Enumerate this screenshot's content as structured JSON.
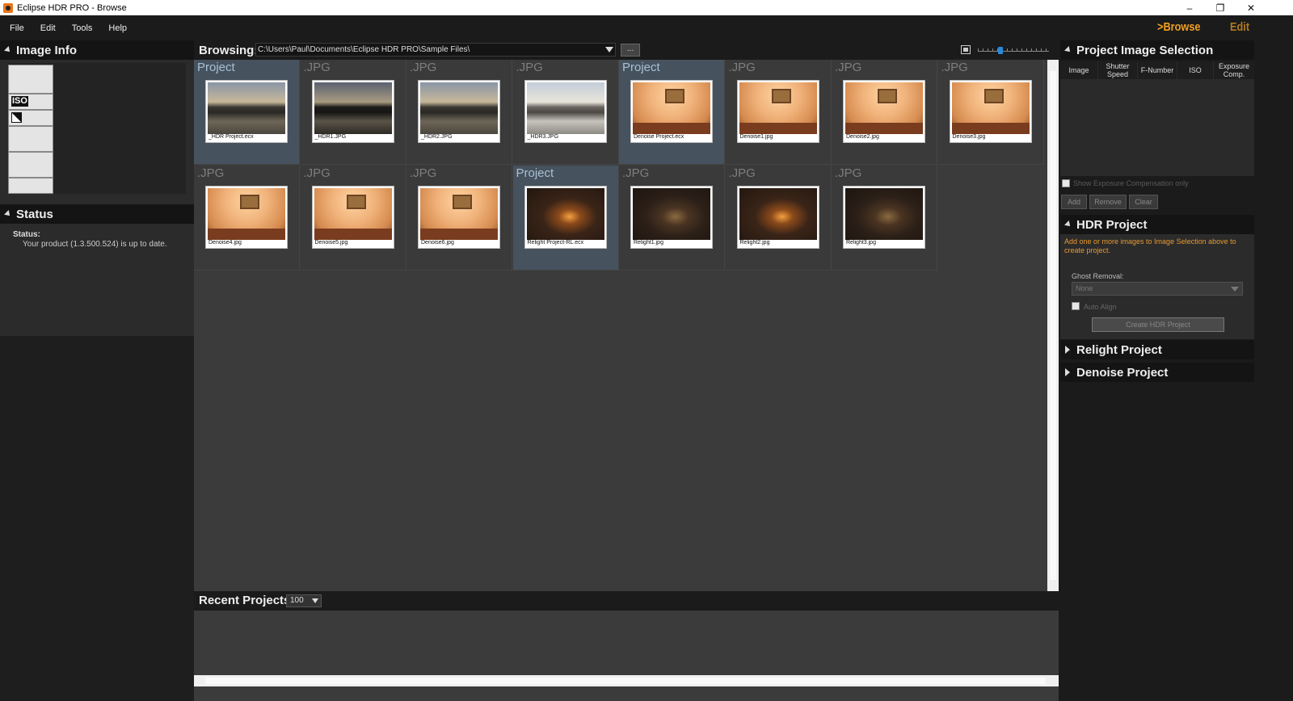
{
  "window": {
    "title": "Eclipse HDR PRO - Browse",
    "minimize": "–",
    "restore": "❐",
    "close": "✕"
  },
  "menu": [
    "File",
    "Edit",
    "Tools",
    "Help"
  ],
  "modes": {
    "browse": ">Browse",
    "edit": "Edit"
  },
  "left": {
    "image_info_title": "Image Info",
    "iso_label": "ISO",
    "status_title": "Status",
    "status_label": "Status:",
    "status_text": "Your product (1.3.500.524) is up to date."
  },
  "browse": {
    "label": "Browsing:",
    "path": "C:\\Users\\Paul\\Documents\\Eclipse HDR PRO\\Sample Files\\",
    "more_button": "...",
    "zoom_level": 0.3
  },
  "thumbnails": [
    {
      "type": "Project",
      "name": "_HDR Project.ecx",
      "kind": "city",
      "tone": ""
    },
    {
      "type": ".JPG",
      "name": "_HDR1.JPG",
      "kind": "city",
      "tone": "dark"
    },
    {
      "type": ".JPG",
      "name": "_HDR2.JPG",
      "kind": "city",
      "tone": ""
    },
    {
      "type": ".JPG",
      "name": "_HDR3.JPG",
      "kind": "city",
      "tone": "bright"
    },
    {
      "type": "Project",
      "name": "Denoise Project.ecx",
      "kind": "vase",
      "tone": ""
    },
    {
      "type": ".JPG",
      "name": "Denoise1.jpg",
      "kind": "vase",
      "tone": ""
    },
    {
      "type": ".JPG",
      "name": "Denoise2.jpg",
      "kind": "vase",
      "tone": ""
    },
    {
      "type": ".JPG",
      "name": "Denoise3.jpg",
      "kind": "vase",
      "tone": ""
    },
    {
      "type": ".JPG",
      "name": "Denoise4.jpg",
      "kind": "vase",
      "tone": ""
    },
    {
      "type": ".JPG",
      "name": "Denoise5.jpg",
      "kind": "vase",
      "tone": ""
    },
    {
      "type": ".JPG",
      "name": "Denoise6.jpg",
      "kind": "vase",
      "tone": ""
    },
    {
      "type": "Project",
      "name": "Relight Project-RL.ecx",
      "kind": "room",
      "tone": ""
    },
    {
      "type": ".JPG",
      "name": "Relight1.jpg",
      "kind": "room",
      "tone": "dim"
    },
    {
      "type": ".JPG",
      "name": "Relight2.jpg",
      "kind": "room",
      "tone": ""
    },
    {
      "type": ".JPG",
      "name": "Relight3.jpg",
      "kind": "room",
      "tone": "dim"
    }
  ],
  "recent": {
    "label": "Recent Projects:",
    "count": "100"
  },
  "right": {
    "selection_title": "Project Image Selection",
    "columns": {
      "image": "Image",
      "shutter": "Shutter Speed",
      "fnumber": "F-Number",
      "iso": "ISO",
      "exposure": "Exposure Comp."
    },
    "show_ec_only": "Show Exposure Compensation only",
    "add": "Add",
    "remove": "Remove",
    "clear": "Clear",
    "hdr_title": "HDR Project",
    "hdr_warning": "Add one or more images to Image Selection above to create project.",
    "ghost_label": "Ghost Removal:",
    "ghost_value": "None",
    "auto_align": "Auto Align",
    "create_button": "Create HDR Project",
    "relight_title": "Relight Project",
    "denoise_title": "Denoise Project"
  }
}
